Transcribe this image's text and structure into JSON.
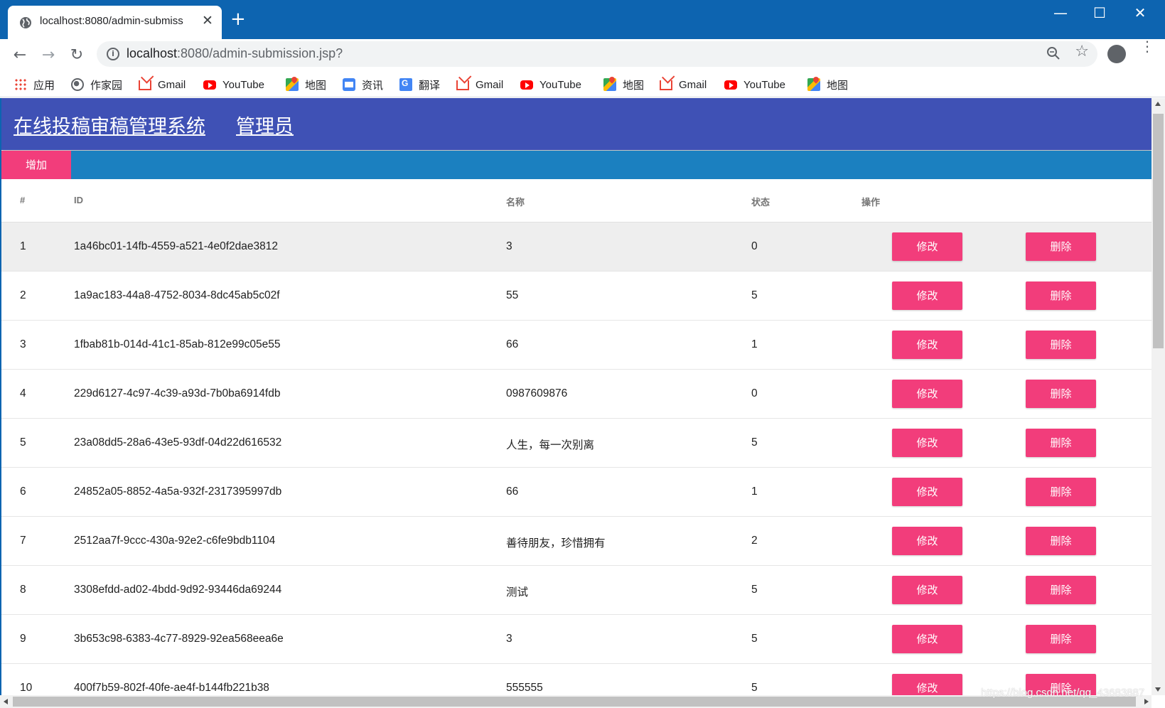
{
  "browser": {
    "tab_title": "localhost:8080/admin-submiss",
    "tab_close": "✕",
    "new_tab": "+",
    "url_host": "localhost",
    "url_rest": ":8080/admin-submission.jsp?",
    "window_controls": {
      "minimize": "—",
      "maximize": "☐",
      "close": "✕"
    },
    "bookmarks": [
      {
        "label": "应用",
        "icon": "apps-grid-icon"
      },
      {
        "label": "作家园",
        "icon": "globe-icon"
      },
      {
        "label": "Gmail",
        "icon": "gmail-icon"
      },
      {
        "label": "YouTube",
        "icon": "youtube-icon"
      },
      {
        "label": "地图",
        "icon": "maps-icon"
      },
      {
        "label": "资讯",
        "icon": "news-icon"
      },
      {
        "label": "翻译",
        "icon": "translate-icon"
      },
      {
        "label": "Gmail",
        "icon": "gmail-icon"
      },
      {
        "label": "YouTube",
        "icon": "youtube-icon"
      },
      {
        "label": "地图",
        "icon": "maps-icon"
      },
      {
        "label": "Gmail",
        "icon": "gmail-icon"
      },
      {
        "label": "YouTube",
        "icon": "youtube-icon"
      },
      {
        "label": "地图",
        "icon": "maps-icon"
      }
    ]
  },
  "app": {
    "brand": "在线投稿审稿管理系统",
    "role": "管理员",
    "add_label": "增加"
  },
  "table": {
    "headers": [
      "#",
      "ID",
      "名称",
      "状态",
      "操作"
    ],
    "edit_label": "修改",
    "delete_label": "删除",
    "rows": [
      {
        "num": "1",
        "id": "1a46bc01-14fb-4559-a521-4e0f2dae3812",
        "name": "3",
        "status": "0"
      },
      {
        "num": "2",
        "id": "1a9ac183-44a8-4752-8034-8dc45ab5c02f",
        "name": "55",
        "status": "5"
      },
      {
        "num": "3",
        "id": "1fbab81b-014d-41c1-85ab-812e99c05e55",
        "name": "66",
        "status": "1"
      },
      {
        "num": "4",
        "id": "229d6127-4c97-4c39-a93d-7b0ba6914fdb",
        "name": "0987609876",
        "status": "0"
      },
      {
        "num": "5",
        "id": "23a08dd5-28a6-43e5-93df-04d22d616532",
        "name": "人生，每一次别离",
        "status": "5"
      },
      {
        "num": "6",
        "id": "24852a05-8852-4a5a-932f-2317395997db",
        "name": "66",
        "status": "1"
      },
      {
        "num": "7",
        "id": "2512aa7f-9ccc-430a-92e2-c6fe9bdb1104",
        "name": "善待朋友，珍惜拥有",
        "status": "2"
      },
      {
        "num": "8",
        "id": "3308efdd-ad02-4bdd-9d92-93446da69244",
        "name": "测试",
        "status": "5"
      },
      {
        "num": "9",
        "id": "3b653c98-6383-4c77-8929-92ea568eea6e",
        "name": "3",
        "status": "5"
      },
      {
        "num": "10",
        "id": "400f7b59-802f-40fe-ae4f-b144fb221b38",
        "name": "555555",
        "status": "5"
      }
    ]
  },
  "watermark": "https://blog.csdn.net/qq_43683887",
  "colors": {
    "header": "#3f51b5",
    "subbar": "#1b80c0",
    "accent": "#f23d7b",
    "chrome": "#0d64b0"
  }
}
